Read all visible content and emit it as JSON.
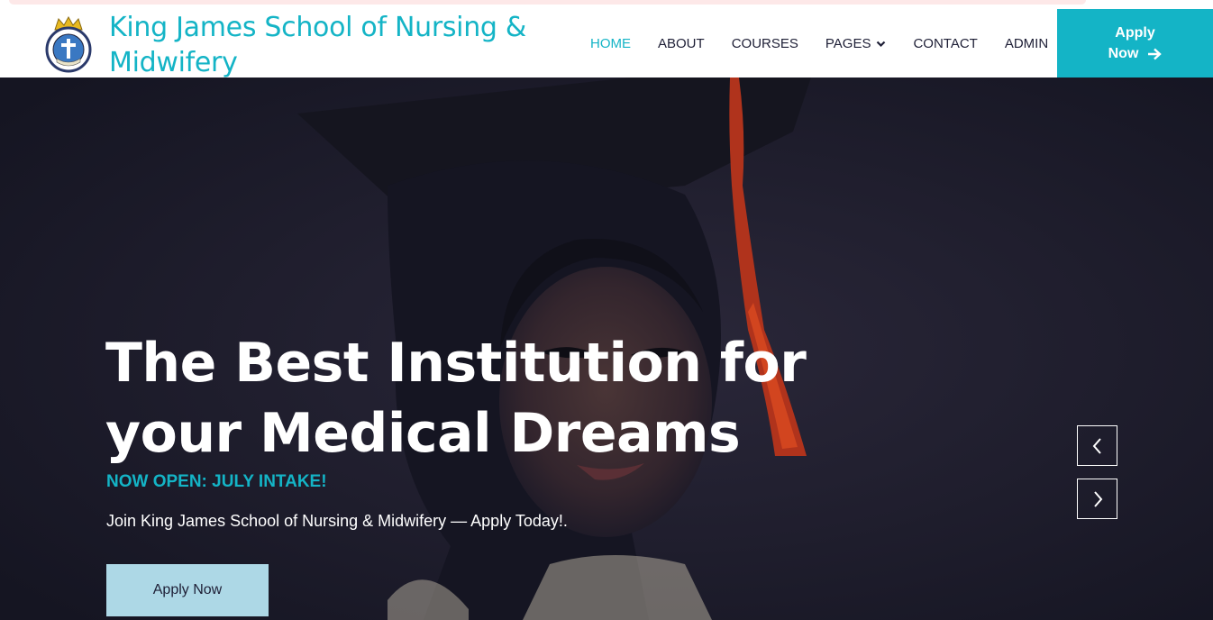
{
  "header": {
    "brand_name": "King James School of Nursing & Midwifery",
    "nav": [
      {
        "label": "HOME",
        "active": true
      },
      {
        "label": "ABOUT",
        "active": false
      },
      {
        "label": "COURSES",
        "active": false
      },
      {
        "label": "PAGES",
        "active": false,
        "has_dropdown": true
      },
      {
        "label": "CONTACT",
        "active": false
      },
      {
        "label": "ADMIN",
        "active": false
      }
    ],
    "apply_button": {
      "line1": "Apply",
      "line2": "Now",
      "icon": "arrow-right-icon"
    }
  },
  "hero": {
    "headline": "The Best Institution for your Medical Dreams",
    "tagline": "NOW OPEN: JULY INTAKE!",
    "subtext": "Join King James School of Nursing & Midwifery — Apply Today!.",
    "cta_label": "Apply Now",
    "prev_icon": "chevron-left-icon",
    "next_icon": "chevron-right-icon"
  },
  "colors": {
    "accent": "#14b4c6",
    "cta_background": "#add8e6",
    "text_dark": "#1e1f36",
    "hero_overlay": "#1d1c2c"
  }
}
